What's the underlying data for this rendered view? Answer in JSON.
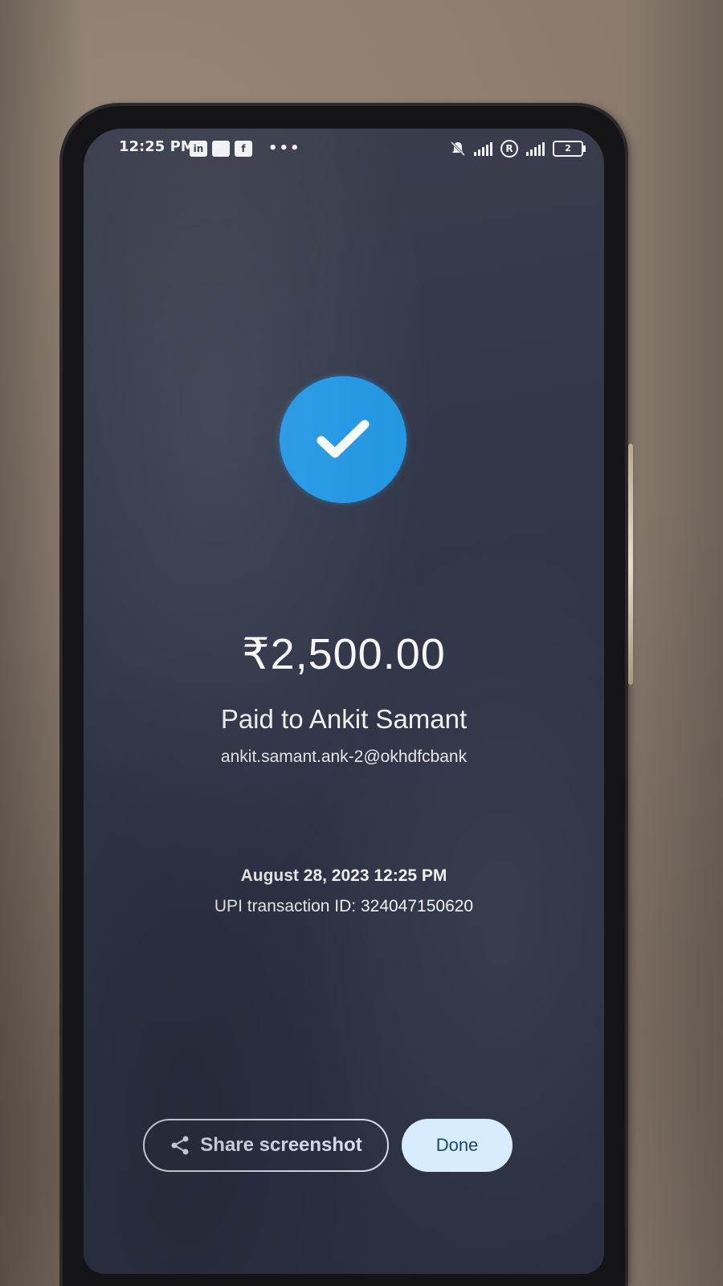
{
  "status_bar": {
    "time": "12:25 PM",
    "app_icons": [
      "linkedin-icon",
      "app-icon",
      "facebook-icon"
    ],
    "more": "•••",
    "battery": "2",
    "sim_indicator": "R"
  },
  "payment": {
    "amount": "₹2,500.00",
    "paid_to": "Paid to Ankit Samant",
    "upi_id": "ankit.samant.ank-2@okhdfcbank",
    "datetime": "August 28, 2023 12:25 PM",
    "transaction_id": "UPI transaction ID: 324047150620",
    "accent_color": "#2196e3"
  },
  "actions": {
    "share_label": "Share screenshot",
    "done_label": "Done"
  }
}
